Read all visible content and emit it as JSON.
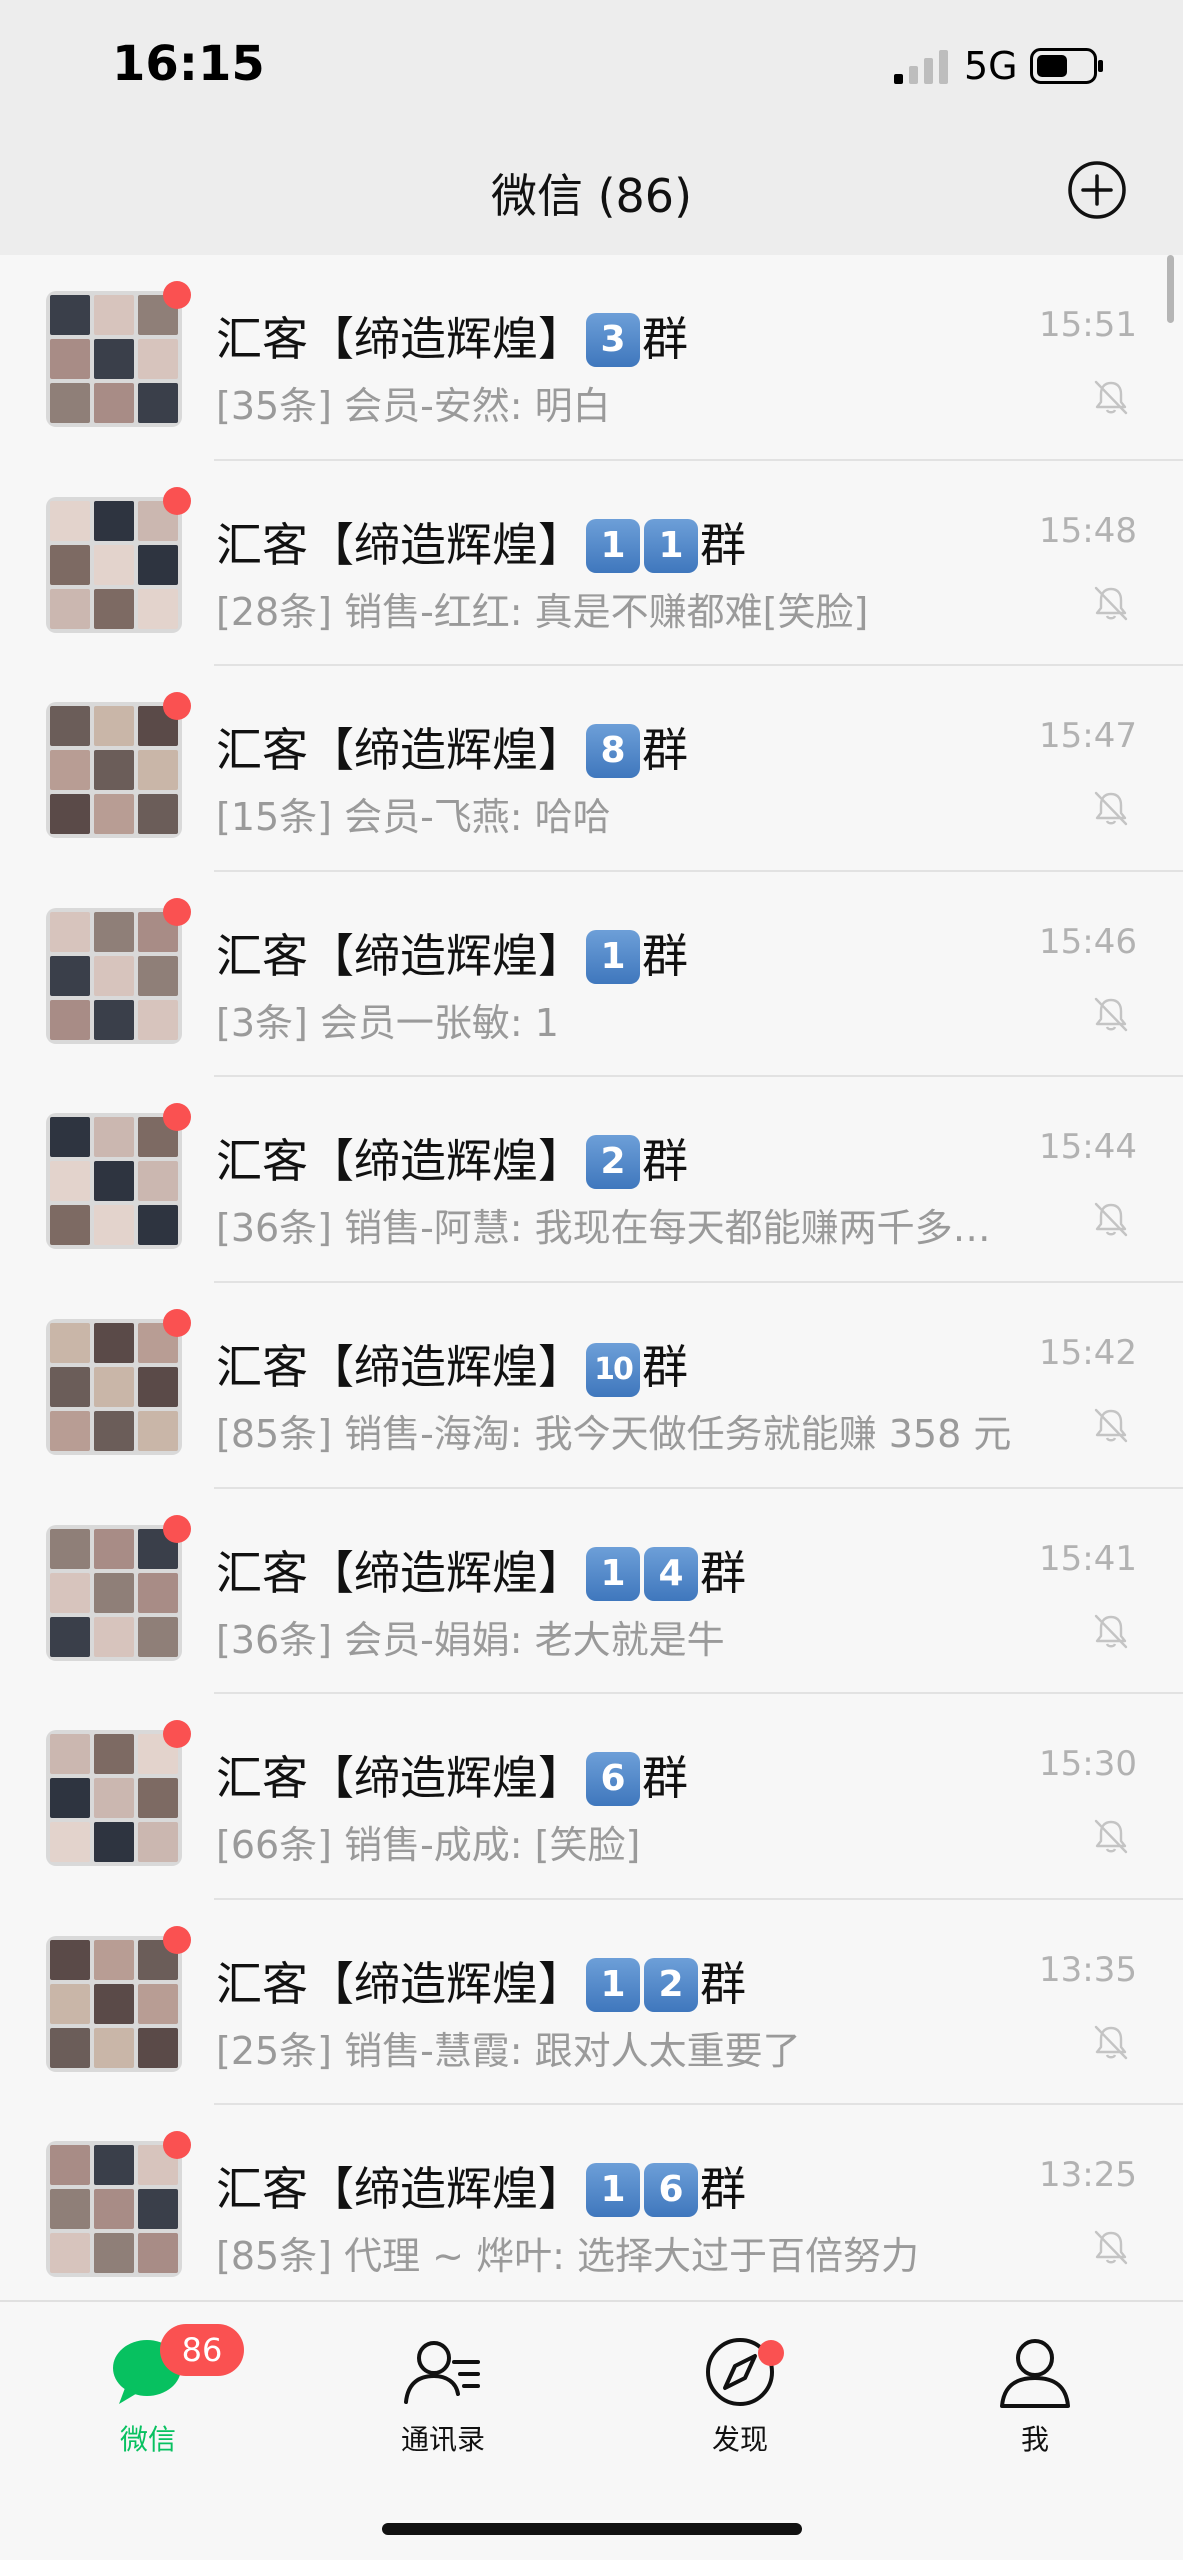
{
  "status_bar": {
    "time": "16:15",
    "network": "5G",
    "signal_icon": "signal-bars-icon",
    "battery_icon": "battery-icon"
  },
  "nav": {
    "title": "微信 (86)",
    "add_icon": "plus-circle-icon"
  },
  "chats": [
    {
      "title_prefix": "汇客【缔造辉煌】",
      "numbers": [
        "3"
      ],
      "title_suffix": "群",
      "preview": "[35条] 会员-安然: 明白",
      "time": "15:51"
    },
    {
      "title_prefix": "汇客【缔造辉煌】",
      "numbers": [
        "1",
        "1"
      ],
      "title_suffix": "群",
      "preview": "[28条] 销售-红红: 真是不赚都难[笑脸]",
      "time": "15:48"
    },
    {
      "title_prefix": "汇客【缔造辉煌】",
      "numbers": [
        "8"
      ],
      "title_suffix": "群",
      "preview": "[15条] 会员-飞燕: 哈哈",
      "time": "15:47"
    },
    {
      "title_prefix": "汇客【缔造辉煌】",
      "numbers": [
        "1"
      ],
      "title_suffix": "群",
      "preview": "[3条] 会员一张敏: 1",
      "time": "15:46"
    },
    {
      "title_prefix": "汇客【缔造辉煌】",
      "numbers": [
        "2"
      ],
      "title_suffix": "群",
      "preview": "[36条] 销售-阿慧: 我现在每天都能赚两千多…",
      "time": "15:44"
    },
    {
      "title_prefix": "汇客【缔造辉煌】",
      "numbers": [
        "10"
      ],
      "title_suffix": "群",
      "preview": "[85条] 销售-海淘: 我今天做任务就能赚 358 元",
      "time": "15:42"
    },
    {
      "title_prefix": "汇客【缔造辉煌】",
      "numbers": [
        "1",
        "4"
      ],
      "title_suffix": "群",
      "preview": "[36条] 会员-娟娟: 老大就是牛",
      "time": "15:41"
    },
    {
      "title_prefix": "汇客【缔造辉煌】",
      "numbers": [
        "6"
      ],
      "title_suffix": "群",
      "preview": "[66条] 销售-成成: [笑脸]",
      "time": "15:30"
    },
    {
      "title_prefix": "汇客【缔造辉煌】",
      "numbers": [
        "1",
        "2"
      ],
      "title_suffix": "群",
      "preview": "[25条] 销售-慧霞: 跟对人太重要了",
      "time": "13:35"
    },
    {
      "title_prefix": "汇客【缔造辉煌】",
      "numbers": [
        "1",
        "6"
      ],
      "title_suffix": "群",
      "preview": "[85条] 代理 ~ 烨叶: 选择大过于百倍努力",
      "time": "13:25"
    }
  ],
  "tabs": [
    {
      "label": "微信",
      "icon": "chat-bubble-icon",
      "badge": "86",
      "active": true
    },
    {
      "label": "通讯录",
      "icon": "contacts-icon"
    },
    {
      "label": "发现",
      "icon": "compass-icon",
      "dot": true
    },
    {
      "label": "我",
      "icon": "person-icon"
    }
  ],
  "colors": {
    "accent": "#07c160",
    "badge": "#fa5151",
    "number_box": "#3f77bd"
  }
}
